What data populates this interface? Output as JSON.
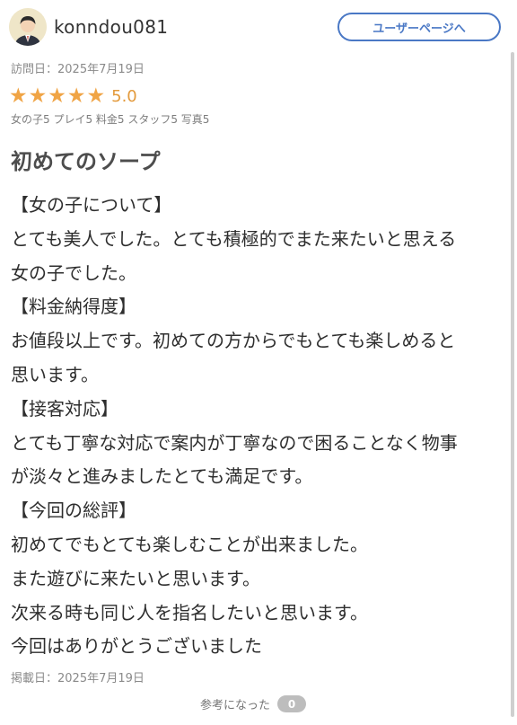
{
  "user": {
    "name": "konndou081",
    "user_page_button": "ユーザーページへ"
  },
  "review": {
    "visit_date": "訪問日：2025年7月19日",
    "stars": 5,
    "score": "5.0",
    "sub_ratings": "女の子5 プレイ5 料金5 スタッフ5 写真5",
    "title": "初めてのソープ",
    "lines": [
      "【女の子について】",
      "とても美人でした。とても積極的でまた来たいと思える",
      "女の子でした。",
      "【料金納得度】",
      "お値段以上です。初めての方からでもとても楽しめると",
      "思います。",
      "【接客対応】",
      "とても丁寧な対応で案内が丁寧なので困ることなく物事",
      "が淡々と進みましたとても満足です。",
      "【今回の総評】",
      "初めてでもとても楽しむことが出来ました。",
      "また遊びに来たいと思います。",
      "次来る時も同じ人を指名したいと思います。",
      "今回はありがとうございました"
    ],
    "posted_date": "掲載日：2025年7月19日",
    "helpful_label": "参考になった",
    "helpful_count": "0"
  },
  "colors": {
    "accent": "#4a78c5",
    "star": "#f0a445",
    "score": "#e39a3c"
  }
}
